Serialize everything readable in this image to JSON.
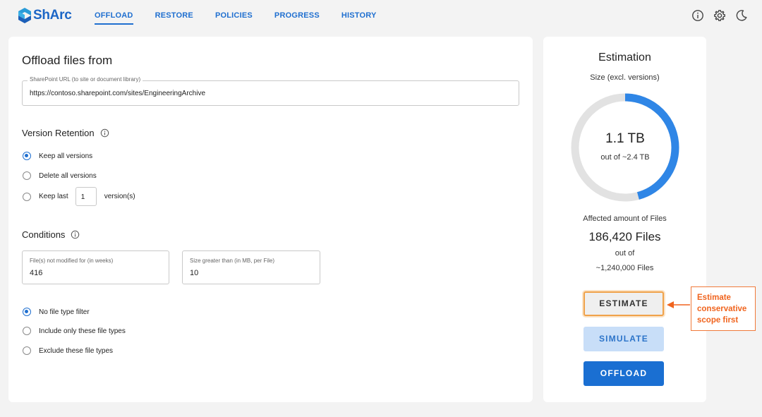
{
  "app": {
    "name": "ShArc",
    "brand_color": "#1c66c6"
  },
  "nav": {
    "tabs": [
      {
        "label": "OFFLOAD",
        "active": true
      },
      {
        "label": "RESTORE",
        "active": false
      },
      {
        "label": "POLICIES",
        "active": false
      },
      {
        "label": "PROGRESS",
        "active": false
      },
      {
        "label": "HISTORY",
        "active": false
      }
    ],
    "icons": [
      "info-icon",
      "gear-icon",
      "moon-icon"
    ]
  },
  "offload": {
    "title": "Offload files from",
    "url_field": {
      "label": "SharePoint URL (to site or document library)",
      "value": "https://contoso.sharepoint.com/sites/EngineeringArchive"
    },
    "version_retention": {
      "title": "Version Retention",
      "options": [
        {
          "label": "Keep all versions",
          "selected": true
        },
        {
          "label": "Delete all versions",
          "selected": false
        },
        {
          "label_prefix": "Keep last",
          "count": "1",
          "label_suffix": "version(s)",
          "selected": false
        }
      ]
    },
    "conditions": {
      "title": "Conditions",
      "not_modified": {
        "label": "File(s) not modified for (in weeks)",
        "value": "416"
      },
      "size_greater": {
        "label": "Size greater than (in MB, per File)",
        "value": "10"
      },
      "file_type_options": [
        {
          "label": "No file type filter",
          "selected": true
        },
        {
          "label": "Include only these file types",
          "selected": false
        },
        {
          "label": "Exclude these file types",
          "selected": false
        }
      ]
    }
  },
  "estimation": {
    "title": "Estimation",
    "size_label": "Size (excl. versions)",
    "size_value": "1.1 TB",
    "size_out_of": "out of ~2.4 TB",
    "size_fraction": 0.458,
    "affected_label": "Affected amount of Files",
    "affected_value": "186,420 Files",
    "affected_out_of": "out of",
    "affected_total": "~1,240,000 Files",
    "buttons": {
      "estimate": "ESTIMATE",
      "simulate": "SIMULATE",
      "offload": "OFFLOAD"
    },
    "colors": {
      "ring_fill": "#2f86e6",
      "ring_track": "#e2e2e2"
    }
  },
  "callout": {
    "lines": [
      "Estimate",
      "conservative",
      "scope first"
    ],
    "color": "#f0641e"
  }
}
